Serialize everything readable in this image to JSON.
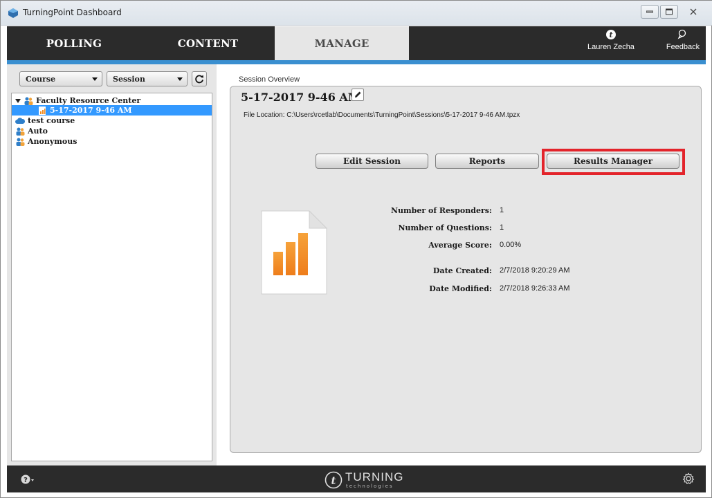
{
  "window": {
    "title": "TurningPoint Dashboard"
  },
  "nav": {
    "tabs": [
      {
        "label": "POLLING"
      },
      {
        "label": "CONTENT"
      },
      {
        "label": "MANAGE"
      }
    ],
    "user_label": "Lauren Zecha",
    "feedback_label": "Feedback"
  },
  "filters": {
    "course_label": "Course",
    "session_label": "Session"
  },
  "tree": [
    {
      "label": "Faculty Resource Center"
    },
    {
      "label": "5-17-2017 9-46 AM"
    },
    {
      "label": "test course"
    },
    {
      "label": "Auto"
    },
    {
      "label": "Anonymous"
    }
  ],
  "overview": {
    "section_label": "Session Overview",
    "session_title": "5-17-2017 9-46 AM",
    "file_location": "File Location: C:\\Users\\rcetlab\\Documents\\TurningPoint\\Sessions\\5-17-2017 9-46 AM.tpzx",
    "buttons": {
      "edit_session": "Edit Session",
      "reports": "Reports",
      "results_manager": "Results Manager"
    },
    "stats": [
      {
        "label": "Number of Responders:",
        "value": "1"
      },
      {
        "label": "Number of Questions:",
        "value": "1"
      },
      {
        "label": "Average Score:",
        "value": "0.00%"
      },
      {
        "label": "Date Created:",
        "value": "2/7/2018 9:20:29 AM"
      },
      {
        "label": "Date Modified:",
        "value": "2/7/2018 9:26:33 AM"
      }
    ]
  },
  "footer": {
    "brand_name": "TURNING",
    "brand_sub": "technologies"
  },
  "colors": {
    "accent_blue": "#3a8fd0",
    "selection": "#3399ff",
    "highlight_red": "#e3242b",
    "dark_bar": "#2b2b2b"
  }
}
